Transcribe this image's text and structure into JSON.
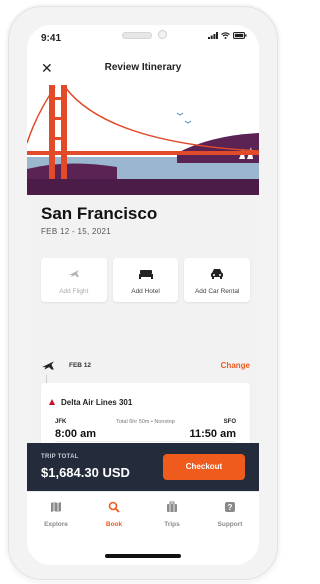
{
  "status_bar": {
    "time": "9:41"
  },
  "header": {
    "title": "Review Itinerary",
    "close_icon": "close-icon"
  },
  "destination": {
    "city": "San Francisco",
    "dates": "FEB 12 - 15, 2021"
  },
  "add_options": [
    {
      "label": "Add Flight",
      "icon": "airplane-icon",
      "enabled": false
    },
    {
      "label": "Add Hotel",
      "icon": "bed-icon",
      "enabled": true
    },
    {
      "label": "Add Car Rental",
      "icon": "car-icon",
      "enabled": true
    }
  ],
  "flight": {
    "date": "FEB 12",
    "change_label": "Change",
    "airline": "Delta Air Lines 301",
    "origin": "JFK",
    "destination": "SFO",
    "duration": "Total 6hr 50m • Nonstop",
    "depart_time": "8:00 am",
    "arrive_time": "11:50 am"
  },
  "checkout": {
    "total_label": "TRIP TOTAL",
    "total_value": "$1,684.30 USD",
    "button_label": "Checkout"
  },
  "tabs": [
    {
      "label": "Explore",
      "icon": "map-icon",
      "active": false
    },
    {
      "label": "Book",
      "icon": "search-icon",
      "active": true
    },
    {
      "label": "Trips",
      "icon": "suitcase-icon",
      "active": false
    },
    {
      "label": "Support",
      "icon": "help-icon",
      "active": false
    }
  ],
  "colors": {
    "accent": "#ef5a1d",
    "checkout_bar": "#242b3a",
    "bridge": "#e24b2a",
    "hill": "#5a2354"
  }
}
